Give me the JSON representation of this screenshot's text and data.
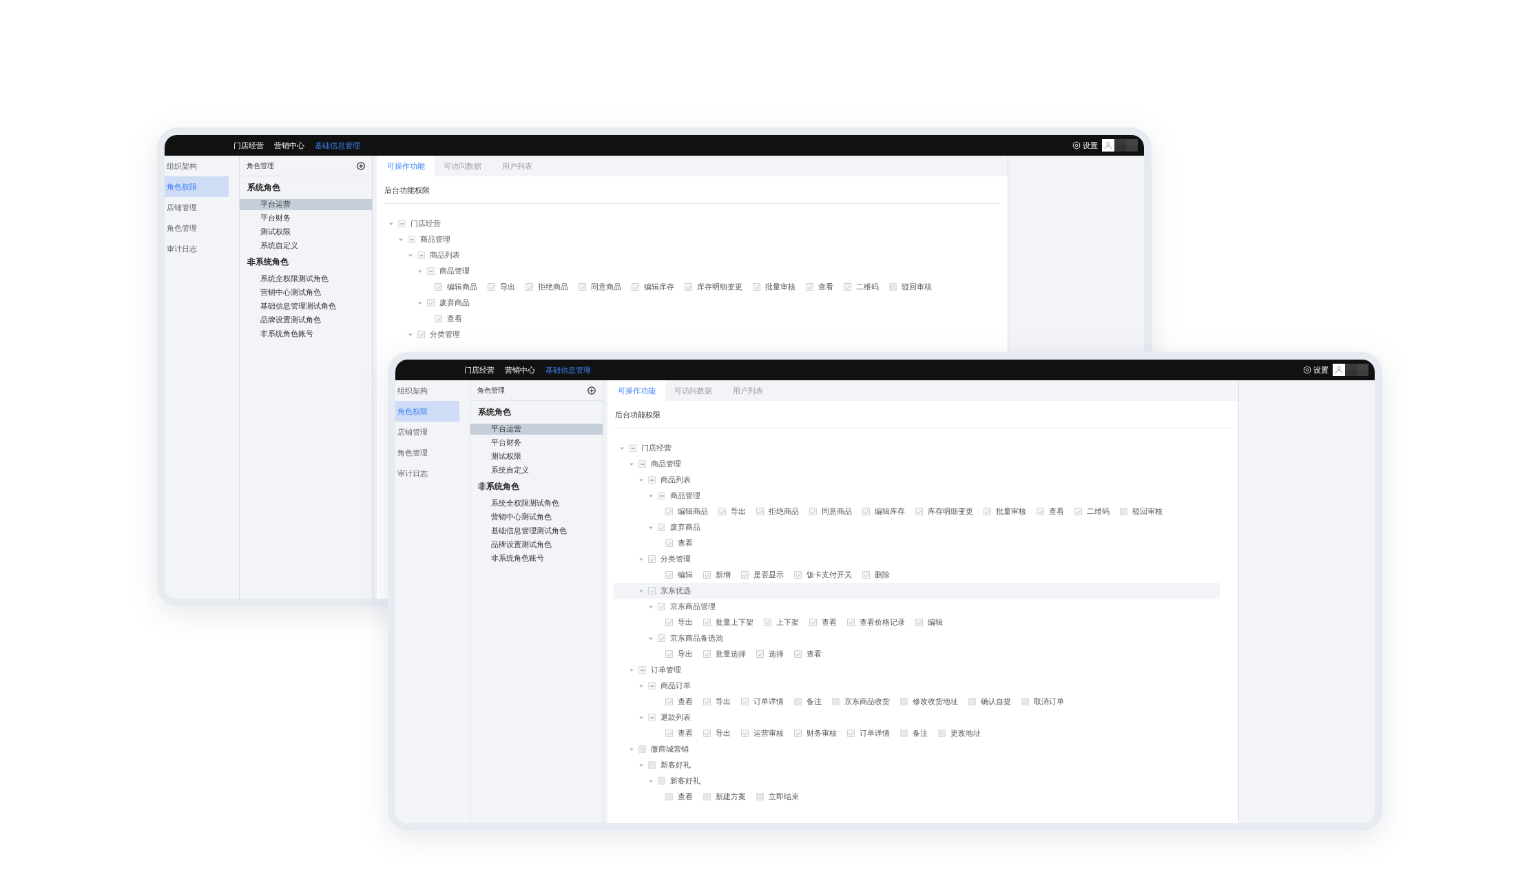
{
  "windows": [
    {
      "nav": [
        {
          "label": "门店经营",
          "selected": false
        },
        {
          "label": "营销中心",
          "selected": false
        },
        {
          "label": "基础信息管理",
          "selected": true
        }
      ],
      "settings": "设置",
      "sidebar": [
        {
          "label": "组织架构",
          "selected": false
        },
        {
          "label": "角色权限",
          "selected": true
        },
        {
          "label": "店铺管理",
          "selected": false
        },
        {
          "label": "角色管理",
          "selected": false
        },
        {
          "label": "审计日志",
          "selected": false
        }
      ],
      "roles_panel": {
        "title": "角色管理",
        "groups": [
          {
            "title": "系统角色",
            "items": [
              {
                "label": "平台运营",
                "selected": true
              },
              {
                "label": "平台财务",
                "selected": false
              },
              {
                "label": "测试权限",
                "selected": false
              },
              {
                "label": "系统自定义",
                "selected": false
              }
            ]
          },
          {
            "title": "非系统角色",
            "items": [
              {
                "label": "系统全权限测试角色",
                "selected": false
              },
              {
                "label": "营销中心测试角色",
                "selected": false
              },
              {
                "label": "基础信息管理测试角色",
                "selected": false
              },
              {
                "label": "品牌设置测试角色",
                "selected": false
              },
              {
                "label": "非系统角色账号",
                "selected": false
              }
            ]
          }
        ]
      },
      "tabs": [
        {
          "label": "可操作功能",
          "selected": true
        },
        {
          "label": "可访问数据",
          "selected": false
        },
        {
          "label": "用户列表",
          "selected": false
        }
      ],
      "section_title": "后台功能权限",
      "tree": [
        {
          "label": "门店经营",
          "checked": false,
          "partial": true,
          "expanded": true,
          "highlighted": false,
          "children": [
            {
              "label": "商品管理",
              "checked": false,
              "partial": true,
              "expanded": true,
              "highlighted": false,
              "children": [
                {
                  "label": "商品列表",
                  "checked": false,
                  "partial": true,
                  "expanded": true,
                  "highlighted": false,
                  "children": [
                    {
                      "label": "商品管理",
                      "checked": false,
                      "partial": true,
                      "expanded": true,
                      "highlighted": false,
                      "permissions": [
                        {
                          "label": "编辑商品",
                          "checked": true
                        },
                        {
                          "label": "导出",
                          "checked": true
                        },
                        {
                          "label": "拒绝商品",
                          "checked": true
                        },
                        {
                          "label": "同意商品",
                          "checked": true
                        },
                        {
                          "label": "编辑库存",
                          "checked": true
                        },
                        {
                          "label": "库存明细变更",
                          "checked": true
                        },
                        {
                          "label": "批量审核",
                          "checked": true
                        },
                        {
                          "label": "查看",
                          "checked": true
                        },
                        {
                          "label": "二维码",
                          "checked": true
                        },
                        {
                          "label": "驳回审核",
                          "checked": false
                        }
                      ]
                    },
                    {
                      "label": "废弃商品",
                      "checked": true,
                      "partial": false,
                      "expanded": true,
                      "highlighted": false,
                      "permissions": [
                        {
                          "label": "查看",
                          "checked": true
                        }
                      ]
                    }
                  ]
                },
                {
                  "label": "分类管理",
                  "checked": true,
                  "partial": false,
                  "expanded": true,
                  "highlighted": false
                }
              ]
            }
          ]
        }
      ]
    },
    {
      "nav": [
        {
          "label": "门店经营",
          "selected": false
        },
        {
          "label": "营销中心",
          "selected": false
        },
        {
          "label": "基础信息管理",
          "selected": true
        }
      ],
      "settings": "设置",
      "sidebar": [
        {
          "label": "组织架构",
          "selected": false
        },
        {
          "label": "角色权限",
          "selected": true
        },
        {
          "label": "店铺管理",
          "selected": false
        },
        {
          "label": "角色管理",
          "selected": false
        },
        {
          "label": "审计日志",
          "selected": false
        }
      ],
      "roles_panel": {
        "title": "角色管理",
        "groups": [
          {
            "title": "系统角色",
            "items": [
              {
                "label": "平台运营",
                "selected": true
              },
              {
                "label": "平台财务",
                "selected": false
              },
              {
                "label": "测试权限",
                "selected": false
              },
              {
                "label": "系统自定义",
                "selected": false
              }
            ]
          },
          {
            "title": "非系统角色",
            "items": [
              {
                "label": "系统全权限测试角色",
                "selected": false
              },
              {
                "label": "营销中心测试角色",
                "selected": false
              },
              {
                "label": "基础信息管理测试角色",
                "selected": false
              },
              {
                "label": "品牌设置测试角色",
                "selected": false
              },
              {
                "label": "非系统角色账号",
                "selected": false
              }
            ]
          }
        ]
      },
      "tabs": [
        {
          "label": "可操作功能",
          "selected": true
        },
        {
          "label": "可访问数据",
          "selected": false
        },
        {
          "label": "用户列表",
          "selected": false
        }
      ],
      "section_title": "后台功能权限",
      "tree": [
        {
          "label": "门店经营",
          "checked": false,
          "partial": true,
          "expanded": true,
          "highlighted": false,
          "children": [
            {
              "label": "商品管理",
              "checked": false,
              "partial": true,
              "expanded": true,
              "highlighted": false,
              "children": [
                {
                  "label": "商品列表",
                  "checked": false,
                  "partial": true,
                  "expanded": true,
                  "highlighted": false,
                  "children": [
                    {
                      "label": "商品管理",
                      "checked": false,
                      "partial": true,
                      "expanded": true,
                      "highlighted": false,
                      "permissions": [
                        {
                          "label": "编辑商品",
                          "checked": true
                        },
                        {
                          "label": "导出",
                          "checked": true
                        },
                        {
                          "label": "拒绝商品",
                          "checked": true
                        },
                        {
                          "label": "同意商品",
                          "checked": true
                        },
                        {
                          "label": "编辑库存",
                          "checked": true
                        },
                        {
                          "label": "库存明细变更",
                          "checked": true
                        },
                        {
                          "label": "批量审核",
                          "checked": true
                        },
                        {
                          "label": "查看",
                          "checked": true
                        },
                        {
                          "label": "二维码",
                          "checked": true
                        },
                        {
                          "label": "驳回审核",
                          "checked": false
                        }
                      ]
                    },
                    {
                      "label": "废弃商品",
                      "checked": true,
                      "partial": false,
                      "expanded": true,
                      "highlighted": false,
                      "permissions": [
                        {
                          "label": "查看",
                          "checked": true
                        }
                      ]
                    }
                  ]
                },
                {
                  "label": "分类管理",
                  "checked": true,
                  "partial": false,
                  "expanded": true,
                  "highlighted": false,
                  "permissions": [
                    {
                      "label": "编辑",
                      "checked": true
                    },
                    {
                      "label": "新增",
                      "checked": true
                    },
                    {
                      "label": "是否显示",
                      "checked": true
                    },
                    {
                      "label": "饭卡支付开关",
                      "checked": true
                    },
                    {
                      "label": "删除",
                      "checked": true
                    }
                  ]
                },
                {
                  "label": "京东优选",
                  "checked": true,
                  "partial": false,
                  "expanded": true,
                  "highlighted": true,
                  "children": [
                    {
                      "label": "京东商品管理",
                      "checked": true,
                      "partial": false,
                      "expanded": true,
                      "highlighted": false,
                      "permissions": [
                        {
                          "label": "导出",
                          "checked": true
                        },
                        {
                          "label": "批量上下架",
                          "checked": true
                        },
                        {
                          "label": "上下架",
                          "checked": true
                        },
                        {
                          "label": "查看",
                          "checked": true
                        },
                        {
                          "label": "查看价格记录",
                          "checked": true
                        },
                        {
                          "label": "编辑",
                          "checked": true
                        }
                      ]
                    },
                    {
                      "label": "京东商品备选池",
                      "checked": true,
                      "partial": false,
                      "expanded": true,
                      "highlighted": false,
                      "permissions": [
                        {
                          "label": "导出",
                          "checked": true
                        },
                        {
                          "label": "批量选择",
                          "checked": true
                        },
                        {
                          "label": "选择",
                          "checked": true
                        },
                        {
                          "label": "查看",
                          "checked": true
                        }
                      ]
                    }
                  ]
                }
              ]
            },
            {
              "label": "订单管理",
              "checked": false,
              "partial": true,
              "expanded": true,
              "highlighted": false,
              "children": [
                {
                  "label": "商品订单",
                  "checked": false,
                  "partial": true,
                  "expanded": true,
                  "highlighted": false,
                  "permissions": [
                    {
                      "label": "查看",
                      "checked": true
                    },
                    {
                      "label": "导出",
                      "checked": true
                    },
                    {
                      "label": "订单详情",
                      "checked": true
                    },
                    {
                      "label": "备注",
                      "checked": false
                    },
                    {
                      "label": "京东商品收货",
                      "checked": false
                    },
                    {
                      "label": "修改收货地址",
                      "checked": false
                    },
                    {
                      "label": "确认自提",
                      "checked": false
                    },
                    {
                      "label": "取消订单",
                      "checked": false
                    }
                  ]
                },
                {
                  "label": "退款列表",
                  "checked": false,
                  "partial": true,
                  "expanded": true,
                  "highlighted": false,
                  "permissions": [
                    {
                      "label": "查看",
                      "checked": true
                    },
                    {
                      "label": "导出",
                      "checked": true
                    },
                    {
                      "label": "运营审核",
                      "checked": true
                    },
                    {
                      "label": "财务审核",
                      "checked": true
                    },
                    {
                      "label": "订单详情",
                      "checked": true
                    },
                    {
                      "label": "备注",
                      "checked": false
                    },
                    {
                      "label": "更改地址",
                      "checked": false
                    }
                  ]
                }
              ]
            },
            {
              "label": "微商城营销",
              "checked": false,
              "partial": false,
              "expanded": true,
              "highlighted": false,
              "children": [
                {
                  "label": "新客好礼",
                  "checked": false,
                  "partial": false,
                  "expanded": true,
                  "highlighted": false,
                  "children": [
                    {
                      "label": "新客好礼",
                      "checked": false,
                      "partial": false,
                      "expanded": true,
                      "highlighted": false,
                      "permissions": [
                        {
                          "label": "查看",
                          "checked": false
                        },
                        {
                          "label": "新建方案",
                          "checked": false
                        },
                        {
                          "label": "立即结束",
                          "checked": false
                        }
                      ]
                    }
                  ]
                }
              ]
            }
          ]
        }
      ]
    }
  ]
}
